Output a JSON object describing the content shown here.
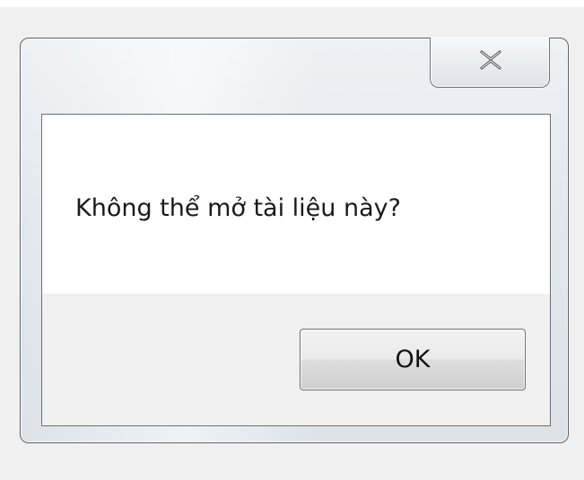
{
  "dialog": {
    "message": "Không thể mở tài liệu này?",
    "ok_label": "OK",
    "close_icon": "close-icon"
  }
}
